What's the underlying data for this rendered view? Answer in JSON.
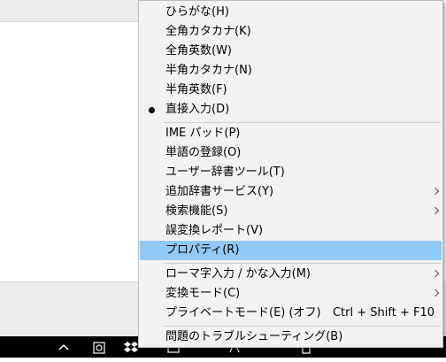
{
  "menu": {
    "items": [
      {
        "label": "ひらがな(H)"
      },
      {
        "label": "全角カタカナ(K)"
      },
      {
        "label": "全角英数(W)"
      },
      {
        "label": "半角カタカナ(N)"
      },
      {
        "label": "半角英数(F)"
      },
      {
        "label": "直接入力(D)",
        "checked": true
      },
      {
        "label": "IME パッド(P)"
      },
      {
        "label": "単語の登録(O)"
      },
      {
        "label": "ユーザー辞書ツール(T)"
      },
      {
        "label": "追加辞書サービス(Y)",
        "submenu": true
      },
      {
        "label": "検索機能(S)",
        "submenu": true
      },
      {
        "label": "誤変換レポート(V)"
      },
      {
        "label": "プロパティ(R)",
        "highlighted": true
      },
      {
        "label": "ローマ字入力 / かな入力(M)",
        "submenu": true
      },
      {
        "label": "変換モード(C)",
        "submenu": true
      },
      {
        "label": "プライベートモード(E) (オフ)",
        "shortcut": "Ctrl + Shift + F10"
      },
      {
        "label": "問題のトラブルシューティング(B)"
      }
    ]
  },
  "colors": {
    "menu_background": "#f2f2f2",
    "highlight": "#91c9f7",
    "taskbar": "#000000"
  },
  "taskbar": {
    "icons": [
      "chevron-up-icon",
      "app-icon",
      "dropbox-icon",
      "app-icon",
      "app-icon",
      "app-icon"
    ]
  }
}
